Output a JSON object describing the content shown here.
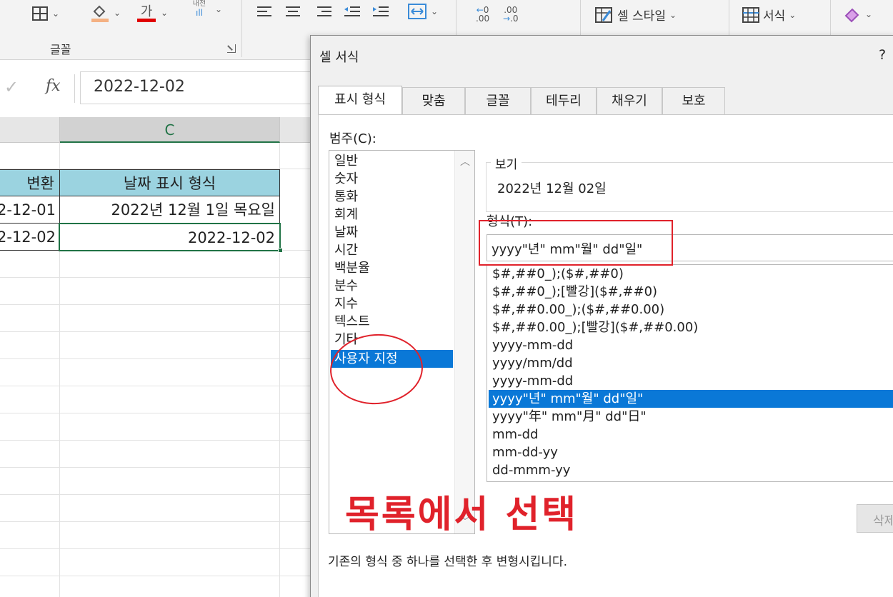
{
  "ribbon": {
    "font_group_label": "글꼴",
    "cell_style_label": "셀 스타일",
    "format_label": "서식",
    "wrap_small_label": "내전",
    "dec_inc_left": ".00",
    "dec_inc_right": ".00"
  },
  "formula_bar": {
    "cancel_glyph": "✓",
    "fx_label": "fx",
    "value": "2022-12-02"
  },
  "sheet": {
    "columns": [
      {
        "letter": "",
        "selected": false
      },
      {
        "letter": "C",
        "selected": true
      }
    ],
    "header_row": {
      "b": "변환",
      "c": "날짜 표시 형식"
    },
    "rows": [
      {
        "b": "2-12-01",
        "c": "2022년 12월 1일 목요일"
      },
      {
        "b": "2-12-02",
        "c": "2022-12-02"
      }
    ]
  },
  "dialog": {
    "title": "셀 서식",
    "help": "?",
    "tabs": [
      {
        "label": "표시 형식",
        "active": true
      },
      {
        "label": "맞춤",
        "active": false
      },
      {
        "label": "글꼴",
        "active": false
      },
      {
        "label": "테두리",
        "active": false
      },
      {
        "label": "채우기",
        "active": false
      },
      {
        "label": "보호",
        "active": false
      }
    ],
    "category_label": "범주(C):",
    "categories": [
      "일반",
      "숫자",
      "통화",
      "회계",
      "날짜",
      "시간",
      "백분율",
      "분수",
      "지수",
      "텍스트",
      "기타",
      "사용자 지정"
    ],
    "selected_category": "사용자 지정",
    "preview_title": "보기",
    "preview_value": "2022년 12월 02일",
    "format_label": "형식(T):",
    "format_value": "yyyy\"년\" mm\"월\" dd\"일\"",
    "format_list": [
      "$#,##0_);($#,##0)",
      "$#,##0_);[빨강]($#,##0)",
      "$#,##0.00_);($#,##0.00)",
      "$#,##0.00_);[빨강]($#,##0.00)",
      "yyyy-mm-dd",
      "yyyy/mm/dd",
      "yyyy-mm-dd",
      "yyyy\"년\" mm\"월\" dd\"일\"",
      "yyyy\"年\" mm\"月\" dd\"日\"",
      "mm-dd",
      "mm-dd-yy",
      "dd-mmm-yy"
    ],
    "selected_format_index": 7,
    "delete_button": "삭제",
    "description": "기존의 형식 중 하나를 선택한 후 변형시킵니다."
  },
  "annotation": {
    "text": "목록에서 선택",
    "color": "#e0222b"
  },
  "colors": {
    "accent_green": "#217346",
    "selection_blue": "#0a78d7",
    "header_fill": "#9bd3e0"
  }
}
